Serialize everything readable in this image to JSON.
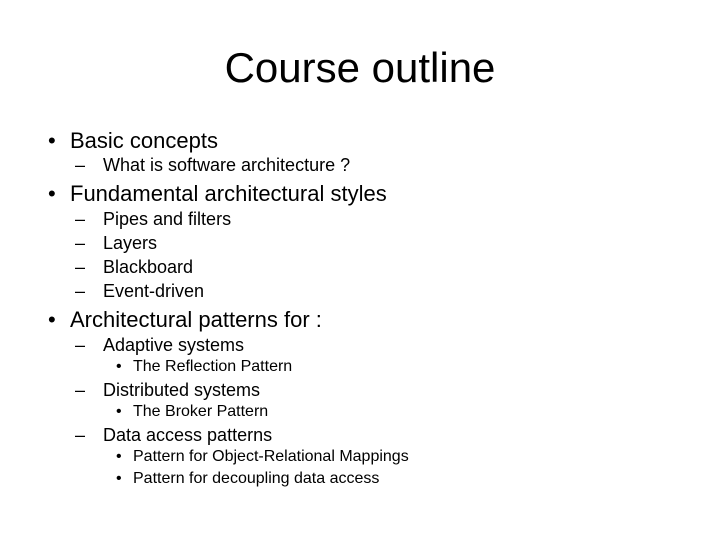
{
  "slide": {
    "title": "Course outline",
    "bullets": {
      "b1": {
        "text": "Basic concepts",
        "sub": [
          "What is software architecture ?"
        ]
      },
      "b2": {
        "text": "Fundamental architectural styles",
        "sub": [
          "Pipes and filters",
          "Layers",
          "Blackboard",
          "Event-driven"
        ]
      },
      "b3": {
        "text": "Architectural patterns for :",
        "sub": [
          {
            "text": "Adaptive systems",
            "items": [
              "The Reflection Pattern"
            ]
          },
          {
            "text": "Distributed systems",
            "items": [
              "The Broker Pattern"
            ]
          },
          {
            "text": "Data access patterns",
            "items": [
              "Pattern for Object-Relational Mappings",
              "Pattern for decoupling data access"
            ]
          }
        ]
      }
    },
    "markers": {
      "level1": "•",
      "level2": "–",
      "level3": "•"
    }
  }
}
